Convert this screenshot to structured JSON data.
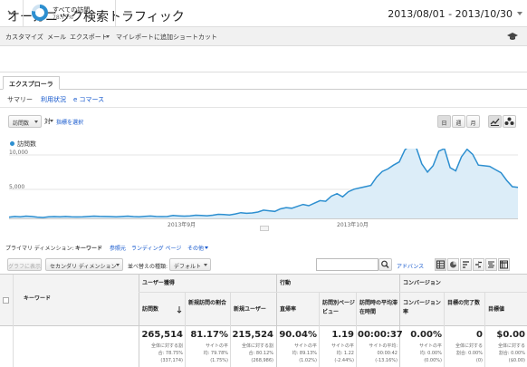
{
  "header": {
    "title": "オーガニック検索トラフィック",
    "date_range": "2013/08/01 - 2013/10/30"
  },
  "toolbar": {
    "items": [
      "カスタマイズ",
      "メール",
      "エクスポート",
      "マイレポートに追加",
      "ショートカット"
    ]
  },
  "segment": {
    "name": "すべての訪問",
    "percent": "78.75%",
    "percent_value": 78.75
  },
  "tabs": {
    "active": "エクスプローラ"
  },
  "subtabs": {
    "summary": "サマリー",
    "usage": "利用状況",
    "ecommerce": "e コマース"
  },
  "controls": {
    "metric": "訪問数",
    "vs": "対",
    "select_metric": "指標を選択",
    "day": "日",
    "week": "週",
    "month": "月"
  },
  "chart_data": {
    "type": "area",
    "legend": "訪問数",
    "yticks": [
      "10,000",
      "5,000"
    ],
    "xticks": [
      "2013年9月",
      "2013年10月"
    ],
    "ylim": [
      0,
      12000
    ],
    "series": [
      {
        "name": "訪問数",
        "color": "#2d8fd0",
        "values": [
          200,
          300,
          250,
          350,
          300,
          200,
          150,
          250,
          280,
          260,
          300,
          250,
          230,
          240,
          300,
          350,
          310,
          300,
          280,
          250,
          300,
          350,
          280,
          260,
          320,
          370,
          300,
          280,
          300,
          450,
          400,
          350,
          380,
          500,
          450,
          420,
          500,
          650,
          600,
          550,
          700,
          900,
          800,
          850,
          1000,
          1300,
          1200,
          1100,
          1500,
          1700,
          1600,
          1900,
          2200,
          2000,
          2400,
          2800,
          2700,
          3500,
          3900,
          3400,
          4200,
          4600,
          4800,
          5000,
          5200,
          6500,
          7400,
          7800,
          8400,
          8900,
          10800,
          11600,
          11200,
          8600,
          7300,
          8300,
          10600,
          11000,
          8000,
          7500,
          9700,
          10900,
          10100,
          8400,
          8300,
          8200,
          7700,
          7200,
          6000,
          5000,
          4900
        ]
      }
    ]
  },
  "dimensions": {
    "label": "プライマリ ディメンション:",
    "keyword": "キーワード",
    "source": "参照元",
    "landing": "ランディング ページ",
    "other": "その他"
  },
  "table_controls": {
    "graph_display": "グラフに表示",
    "secondary_dim": "セカンダリ ディメンション",
    "sort_label": "並べ替えの種類:",
    "sort_value": "デフォルト",
    "advanced": "アドバンス"
  },
  "table": {
    "keyword_header": "キーワード",
    "groups": [
      "ユーザー獲得",
      "行動",
      "コンバージョン"
    ],
    "columns": [
      "訪問数",
      "新規訪問の割合",
      "新規ユーザー",
      "直帰率",
      "訪問別ページビュー",
      "訪問時の平均滞在時間",
      "コンバージョン率",
      "目標の完了数",
      "目標値"
    ],
    "totals": [
      {
        "value": "265,514",
        "sub1": "全体に対する割",
        "sub2": "合: 78.75%",
        "sub3": "(337,174)"
      },
      {
        "value": "81.17%",
        "sub1": "サイトの平",
        "sub2": "均: 79.78%",
        "sub3": "(1.75%)"
      },
      {
        "value": "215,524",
        "sub1": "全体に対する割",
        "sub2": "合: 80.12%",
        "sub3": "(268,986)"
      },
      {
        "value": "90.04%",
        "sub1": "サイトの平",
        "sub2": "均: 89.13%",
        "sub3": "(1.02%)"
      },
      {
        "value": "1.19",
        "sub1": "サイトの平",
        "sub2": "均: 1.22",
        "sub3": "(-2.44%)"
      },
      {
        "value": "00:00:37",
        "sub1": "サイトの平均:",
        "sub2": "00:00:42",
        "sub3": "(-13.16%)"
      },
      {
        "value": "0.00%",
        "sub1": "サイトの平",
        "sub2": "均: 0.00%",
        "sub3": "(0.00%)"
      },
      {
        "value": "0",
        "sub1": "全体に対する",
        "sub2": "割合: 0.00%",
        "sub3": "(0)"
      },
      {
        "value": "$0.00",
        "sub1": "全体に対する",
        "sub2": "割合: 0.00%",
        "sub3": "($0.00)"
      }
    ]
  }
}
